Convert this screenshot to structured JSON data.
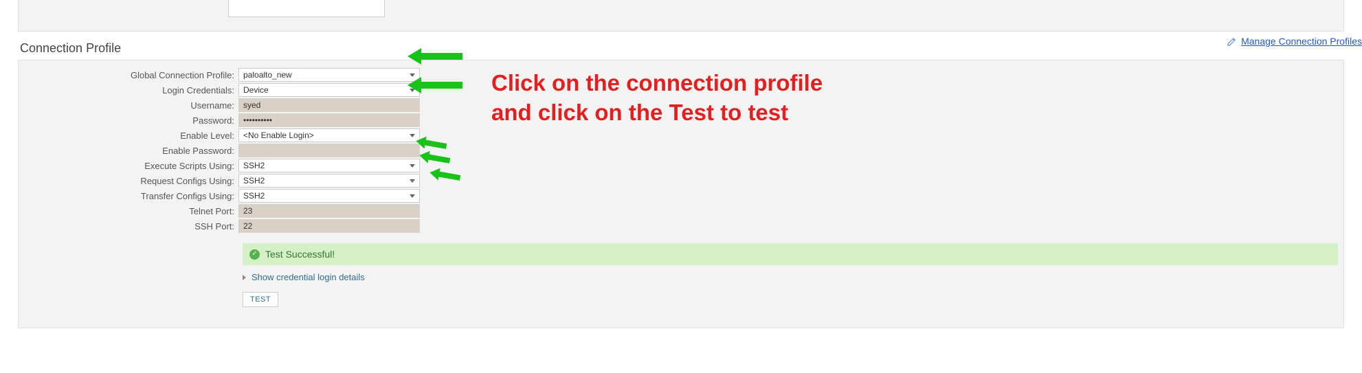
{
  "panel_title": "Connection Profile",
  "manage_link_text": "Manage Connection Profiles",
  "fields": {
    "global_profile": {
      "label": "Global Connection Profile:",
      "value": "paloalto_new"
    },
    "login_credentials": {
      "label": "Login Credentials:",
      "value": "Device"
    },
    "username": {
      "label": "Username:",
      "value": "syed"
    },
    "password": {
      "label": "Password:",
      "value": "••••••••••"
    },
    "enable_level": {
      "label": "Enable Level:",
      "value": "<No Enable Login>"
    },
    "enable_password": {
      "label": "Enable Password:",
      "value": ""
    },
    "execute_scripts": {
      "label": "Execute Scripts Using:",
      "value": "SSH2"
    },
    "request_configs": {
      "label": "Request Configs Using:",
      "value": "SSH2"
    },
    "transfer_configs": {
      "label": "Transfer Configs Using:",
      "value": "SSH2"
    },
    "telnet_port": {
      "label": "Telnet Port:",
      "value": "23"
    },
    "ssh_port": {
      "label": "SSH Port:",
      "value": "22"
    }
  },
  "status_text": "Test Successful!",
  "show_details_text": "Show credential login details",
  "test_button_label": "TEST",
  "annotation": {
    "line1": "Click on the connection profile",
    "line2": "and click on the Test to test"
  }
}
